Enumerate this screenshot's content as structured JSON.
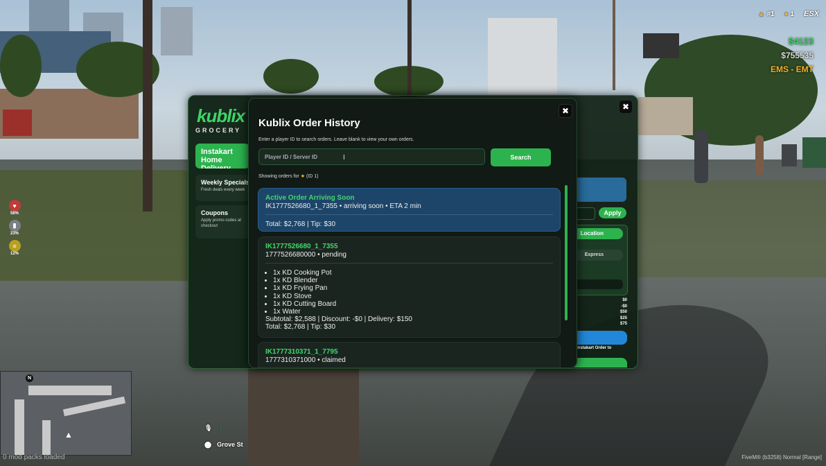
{
  "hud": {
    "rank": "#1",
    "count": "1",
    "framework": "ESX",
    "cash": "$4123",
    "bank": "$755535",
    "job": "EMS - EMT"
  },
  "status": [
    {
      "icon": "heart-icon",
      "value": "58%",
      "color": "#c23a3a"
    },
    {
      "icon": "armor-icon",
      "value": "23%",
      "color": "#7b7f86"
    },
    {
      "icon": "food-icon",
      "value": "12%",
      "color": "#b9a020"
    }
  ],
  "location": {
    "street": "Grove St",
    "compass": "N"
  },
  "footer": {
    "mods": "0 mod packs loaded",
    "fivem": "FiveM® (b3258)",
    "voice": "Normal [Range]"
  },
  "shop": {
    "logo": "kublix",
    "logo_sub": "GROCERY",
    "nav": [
      {
        "label": "Instakart Home Delivery"
      },
      {
        "label": "Weekly Specials",
        "desc": "Fresh deals every week"
      },
      {
        "label": "Coupons",
        "desc1": "Apply promo codes at",
        "desc2": "checkout"
      }
    ],
    "apply_label": "Apply",
    "location_label": "Location",
    "express_label": "Express",
    "prices": [
      "$0",
      "-$0",
      "$50",
      "$25",
      "$75"
    ],
    "instakart_order_label": "Instakart Order to"
  },
  "modal": {
    "title": "Kublix Order History",
    "hint": "Enter a player ID to search orders. Leave blank to view your own orders.",
    "search_placeholder": "Player ID / Server ID",
    "search_button": "Search",
    "showing_prefix": "Showing orders for",
    "showing_suffix": "(ID 1)",
    "active": {
      "title": "Active Order Arriving Soon",
      "line": "IK1777526680_1_7355 • arriving soon • ETA 2 min",
      "total": "Total: $2,768 | Tip: $30"
    },
    "orders": [
      {
        "id": "IK1777526680_1_7355",
        "meta": "1777526680000 • pending",
        "items": [
          "1x KD Cooking Pot",
          "1x KD Blender",
          "1x KD Frying Pan",
          "1x KD Stove",
          "1x KD Cutting Board",
          "1x Water"
        ],
        "subtotal": "Subtotal: $2,588 | Discount: -$0 | Delivery: $150",
        "total": "Total: $2,768 | Tip: $30"
      },
      {
        "id": "IK1777310371_1_7795",
        "meta": "1777310371000 • claimed"
      }
    ]
  }
}
